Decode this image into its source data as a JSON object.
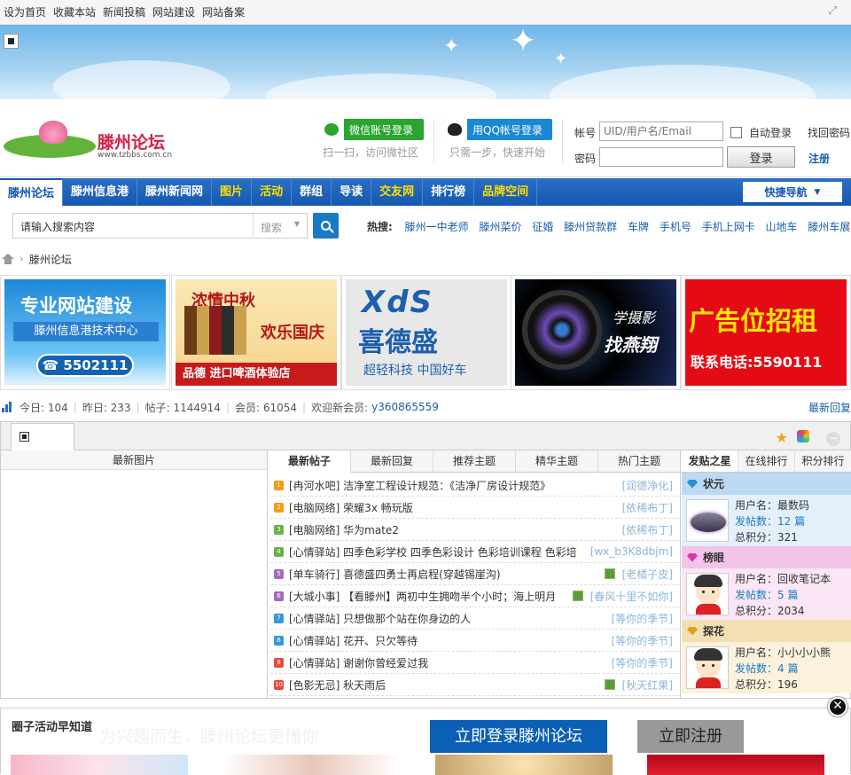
{
  "topbar": {
    "links": [
      "设为首页",
      "收藏本站",
      "新闻投稿",
      "网站建设",
      "网站备案"
    ]
  },
  "logo": {
    "name": "滕州论坛",
    "url": "www.tzbbs.com.cn"
  },
  "social": {
    "wechat_label": "微信账号登录",
    "wechat_sub": "扫一扫，访问微社区",
    "qq_label": "用QQ帐号登录",
    "qq_sub": "只需一步，快速开始"
  },
  "login": {
    "account_label": "帐号",
    "account_placeholder": "UID/用户名/Email",
    "password_label": "密码",
    "auto_login": "自动登录",
    "forgot": "找回密码",
    "login_btn": "登录",
    "register": "注册"
  },
  "nav": {
    "items": [
      "滕州论坛",
      "滕州信息港",
      "滕州新闻网",
      "图片",
      "活动",
      "群组",
      "导读",
      "交友网",
      "排行榜",
      "品牌空间"
    ],
    "quick": "快捷导航"
  },
  "search": {
    "placeholder": "请输入搜索内容",
    "type": "搜索",
    "hot_label": "热搜:",
    "hot": [
      "滕州一中老师",
      "滕州菜价",
      "征婚",
      "滕州贷款群",
      "车牌",
      "手机号",
      "手机上网卡",
      "山地车",
      "滕州车展"
    ]
  },
  "breadcrumb": {
    "current": "滕州论坛"
  },
  "ads": [
    {
      "line1": "专业网站建设",
      "line2": "滕州信息港技术中心",
      "line3": "☎ 5502111"
    },
    {
      "line1": "浓情中秋",
      "line2": "欢乐国庆",
      "line3": "品德 进口啤酒体验店"
    },
    {
      "line1": "XdS",
      "line2": "喜德盛",
      "line3": "超轻科技  中国好车"
    },
    {
      "line1": "学摄影",
      "line2": "找燕翔"
    },
    {
      "line1": "广告位招租",
      "line2": "联系电话:5590111"
    }
  ],
  "stats": {
    "today": "今日: 104",
    "yesterday": "昨日: 233",
    "posts": "帖子: 1144914",
    "members": "会员: 61054",
    "welcome": "欢迎新会员:",
    "new_member": "y360865559",
    "latest_reply": "最新回复"
  },
  "panel": {
    "left_title": "最新图片",
    "tabs": [
      "最新帖子",
      "最新回复",
      "推荐主题",
      "精华主题",
      "热门主题"
    ],
    "posts": [
      {
        "n": "1",
        "color": "#f39c12",
        "title": "[冉河水吧] 洁净室工程设计规范：《洁净厂房设计规范》",
        "user": "[润德净化]",
        "img": false
      },
      {
        "n": "2",
        "color": "#f39c12",
        "title": "[电脑网络] 荣耀3x 畅玩版",
        "user": "[依稀布丁]",
        "img": false
      },
      {
        "n": "3",
        "color": "#6ab04c",
        "title": "[电脑网络] 华为mate2",
        "user": "[依稀布丁]",
        "img": false
      },
      {
        "n": "4",
        "color": "#6ab04c",
        "title": "[心情驿站] 四季色彩学校 四季色彩设计 色彩培训课程 色彩培",
        "user": "[wx_b3K8dbjm]",
        "img": false
      },
      {
        "n": "5",
        "color": "#a569bd",
        "title": "[单车骑行] 喜德盛四勇士再启程(穿越锡崖沟)",
        "user": "[老橘子皮]",
        "img": true
      },
      {
        "n": "6",
        "color": "#a569bd",
        "title": "[大城小事] 【看滕州】两初中生拥吻半个小时；海上明月",
        "user": "[春风十里不如你]",
        "img": true
      },
      {
        "n": "7",
        "color": "#3498db",
        "title": "[心情驿站] 只想做那个站在你身边的人",
        "user": "[等你的季节]",
        "img": false
      },
      {
        "n": "8",
        "color": "#3498db",
        "title": "[心情驿站] 花开、只欠等待",
        "user": "[等你的季节]",
        "img": false
      },
      {
        "n": "9",
        "color": "#e74c3c",
        "title": "[心情驿站] 谢谢你曾经爱过我",
        "user": "[等你的季节]",
        "img": false
      },
      {
        "n": "10",
        "color": "#e74c3c",
        "title": "[色影无忌] 秋天雨后",
        "user": "[秋天红果]",
        "img": true
      }
    ],
    "right_tabs": [
      "发贴之星",
      "在线排行",
      "积分排行"
    ],
    "ranks": [
      {
        "title": "状元",
        "bg": "#e3f0fb",
        "hd": "#bcd9f3",
        "icon": "#2a8bd6",
        "user": "用户名：最数码",
        "count": "发帖数：12 篇",
        "score": "总积分：321"
      },
      {
        "title": "榜眼",
        "bg": "#fbe6f5",
        "hd": "#f3c4e8",
        "icon": "#d63aa8",
        "user": "用户名：回收笔记本",
        "count": "发帖数：5 篇",
        "score": "总积分：2034"
      },
      {
        "title": "探花",
        "bg": "#fbf1dd",
        "hd": "#f3dfb2",
        "icon": "#e1a21b",
        "user": "用户名：小小小小熊",
        "count": "发帖数：4 篇",
        "score": "总积分：196"
      }
    ]
  },
  "bottom": {
    "title": "圈子活动早知道",
    "ghost": "为兴趣而生，滕州论坛更懂你",
    "login_btn": "立即登录滕州论坛",
    "register_btn": "立即注册"
  }
}
